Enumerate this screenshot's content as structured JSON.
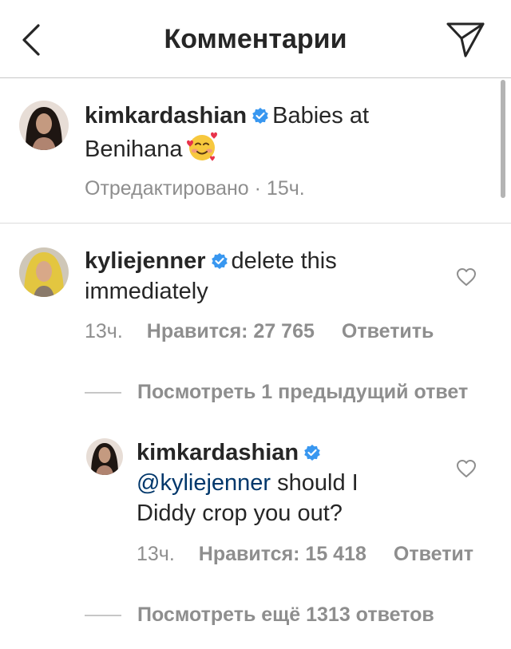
{
  "header": {
    "title": "Комментарии"
  },
  "post": {
    "username": "kimkardashian",
    "caption_line1": "Babies at",
    "caption_line2": "Benihana",
    "emoji": "smiling-face-with-hearts",
    "meta": "Отредактировано · 15ч."
  },
  "comment": {
    "username": "kyliejenner",
    "text_line1": "delete this",
    "text_line2": "immediately",
    "time": "13ч.",
    "likes": "Нравится: 27 765",
    "reply": "Ответить",
    "view_previous": "Посмотреть 1 предыдущий ответ"
  },
  "reply": {
    "username": "kimkardashian",
    "mention": "@kyliejenner",
    "text_line1": " should I",
    "text_line2": "Diddy crop you out?",
    "time": "13ч.",
    "likes": "Нравится: 15 418",
    "reply": "Ответит",
    "view_more": "Посмотреть ещё 1313 ответов"
  },
  "colors": {
    "verified_blue": "#3897f0",
    "mention_blue": "#00376b",
    "meta_gray": "#8e8e8e",
    "text_dark": "#262626"
  }
}
